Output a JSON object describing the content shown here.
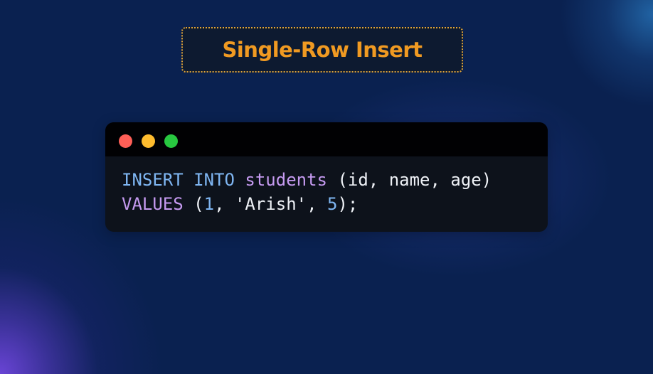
{
  "title": "Single-Row Insert",
  "window_controls": [
    "close-dot",
    "minimize-dot",
    "maximize-dot"
  ],
  "code": {
    "line1": {
      "kw1": "INSERT",
      "sp1": " ",
      "kw2": "INTO",
      "sp2": " ",
      "table": "students",
      "rest": " (id, name, age)"
    },
    "line2": {
      "kw": "VALUES",
      "p1": " (",
      "n1": "1",
      "p2": ", 'Arish', ",
      "n2": "5",
      "p3": ");"
    }
  },
  "colors": {
    "background": "#0a2150",
    "title": "#f09a22",
    "keyword": "#7fb6f2",
    "identifier": "#c59af0",
    "close": "#fe5f57",
    "minimize": "#febc2e",
    "maximize": "#28c840"
  }
}
